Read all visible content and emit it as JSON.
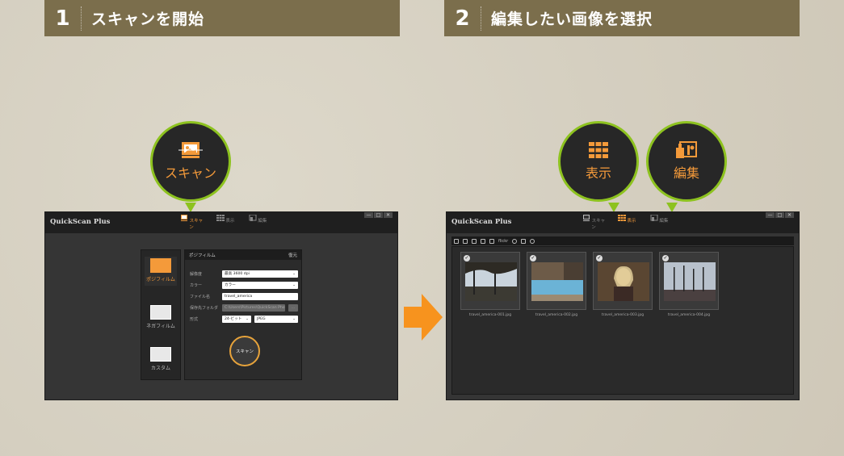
{
  "steps": [
    {
      "num": "1",
      "title": "スキャンを開始"
    },
    {
      "num": "2",
      "title": "編集したい画像を選択"
    }
  ],
  "bubbles": {
    "scan": "スキャン",
    "view": "表示",
    "edit": "編集"
  },
  "app": {
    "title": "QuickScan Plus",
    "nav": {
      "scan": "スキャン",
      "view": "表示",
      "edit": "編集"
    },
    "win": {
      "min": "—",
      "restore": "□",
      "close": "✕"
    }
  },
  "scan_screen": {
    "film_types": [
      {
        "label": "ポジフィルム"
      },
      {
        "label": "ネガフィルム"
      },
      {
        "label": "カスタム"
      }
    ],
    "panel_title": "ポジフィルム",
    "reset_label": "復元",
    "fields": {
      "resolution_label": "解像度",
      "resolution_value": "最高 3600 dpi",
      "color_label": "カラー",
      "color_value": "カラー",
      "filename_label": "ファイル名",
      "filename_value": "travel_america",
      "folder_label": "保存先フォルダ",
      "folder_value": "C:\\Users\\Pictures\\QuickScan Photo",
      "folder_browse": "...",
      "format_label": "形式",
      "bit_value": "24-ビット",
      "format_value": "JPEG"
    },
    "scan_button": "スキャン"
  },
  "gallery_screen": {
    "toolbar": {
      "flickr": "flickr"
    },
    "thumbs": [
      {
        "caption": "travel_america-001.jpg"
      },
      {
        "caption": "travel_america-002.jpg"
      },
      {
        "caption": "travel_america-003.jpg"
      },
      {
        "caption": "travel_america-004.jpg"
      }
    ],
    "check": "✓"
  },
  "colors": {
    "header_bg": "#7b6e4c",
    "bubble_border": "#8dc21f",
    "accent": "#f49a3a",
    "arrow": "#f7931e"
  }
}
